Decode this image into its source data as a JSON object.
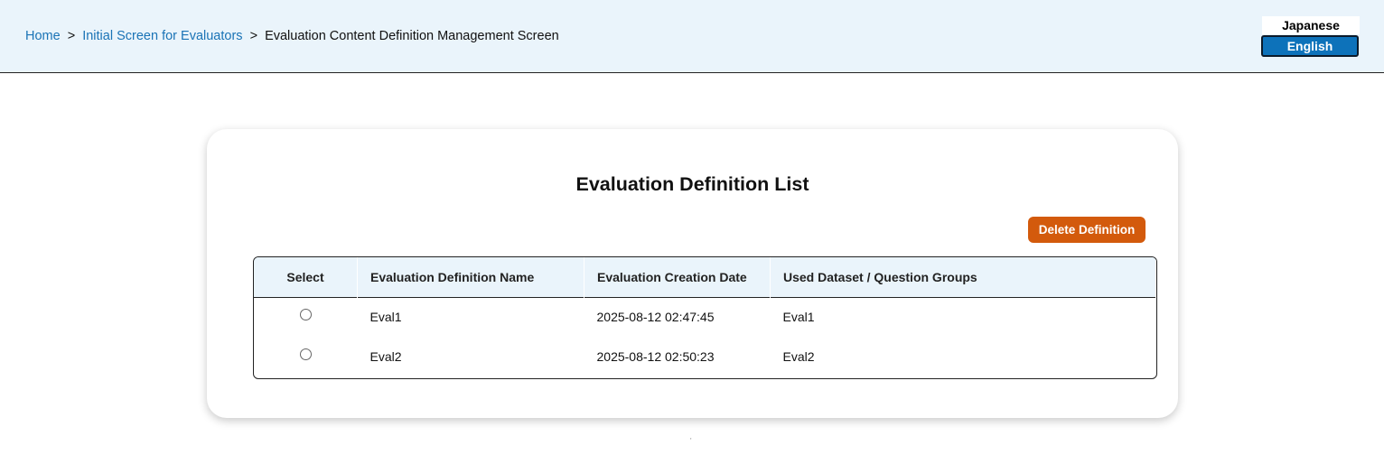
{
  "header": {
    "breadcrumb": {
      "home": "Home",
      "sep1": ">",
      "evaluators": "Initial Screen for Evaluators",
      "sep2": ">",
      "current": "Evaluation Content Definition Management Screen"
    },
    "language": {
      "japanese": "Japanese",
      "english": "English",
      "selected": "English"
    }
  },
  "main": {
    "title": "Evaluation Definition List",
    "delete_button": "Delete Definition",
    "table": {
      "columns": [
        "Select",
        "Evaluation Definition Name",
        "Evaluation Creation Date",
        "Used Dataset / Question Groups"
      ],
      "rows": [
        {
          "name": "Eval1",
          "date": "2025-08-12 02:47:45",
          "dataset": "Eval1"
        },
        {
          "name": "Eval2",
          "date": "2025-08-12 02:50:23",
          "dataset": "Eval2"
        }
      ]
    }
  },
  "footer": {
    "dot": "'"
  },
  "colors": {
    "header_bg": "#eaf4fb",
    "link": "#1a73b6",
    "accent_blue": "#0d72ba",
    "delete_orange": "#d35a0c"
  }
}
